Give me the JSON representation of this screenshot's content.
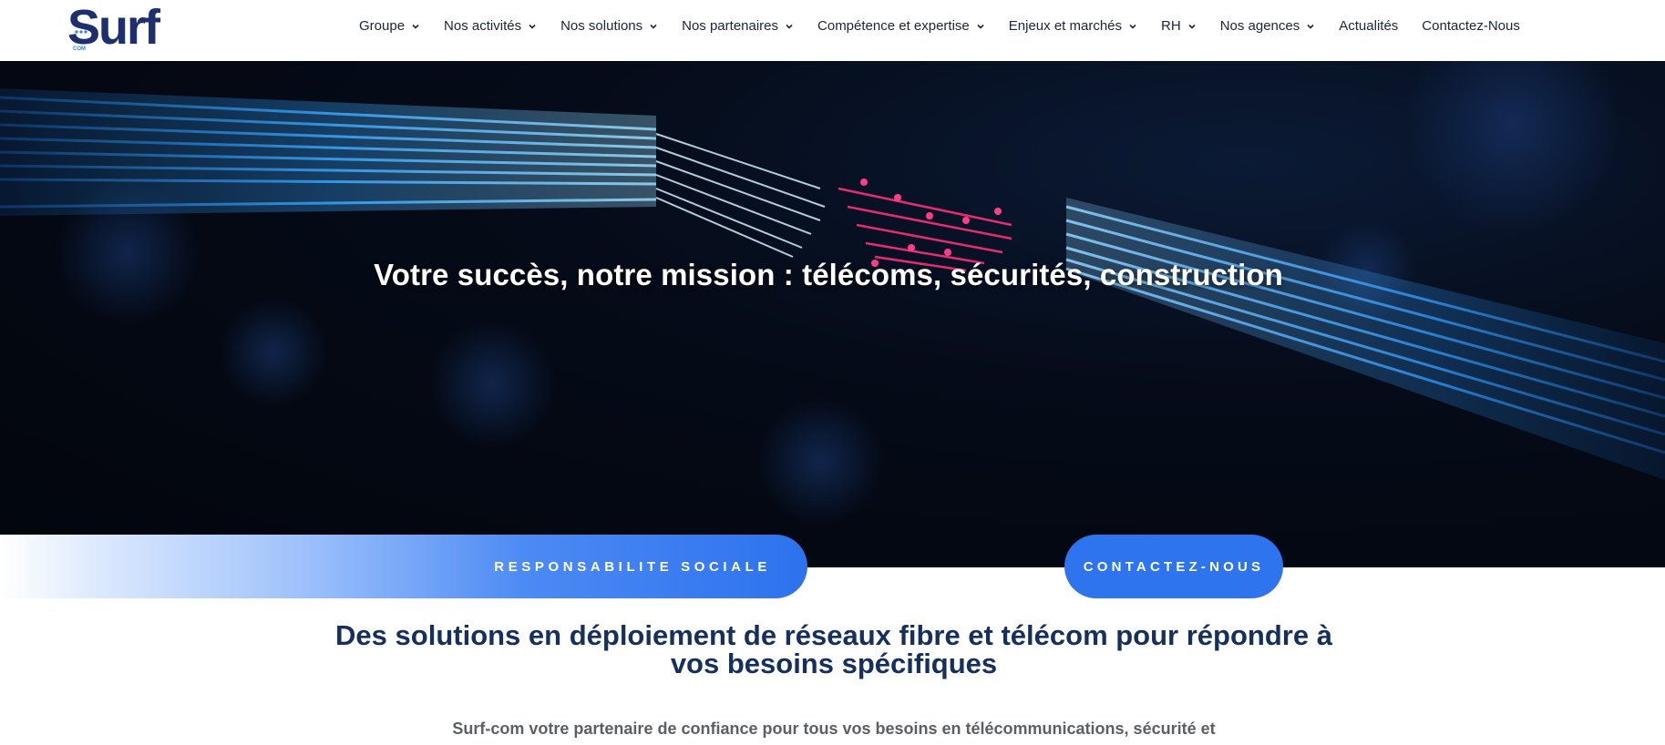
{
  "header": {
    "logo": {
      "brand": "Surf",
      "sub": "COM",
      "brand_color": "#1d2f6f",
      "accent_color": "#2f7ff0"
    },
    "nav": [
      {
        "label": "Groupe",
        "dropdown": true
      },
      {
        "label": "Nos activités",
        "dropdown": true
      },
      {
        "label": "Nos solutions",
        "dropdown": true
      },
      {
        "label": "Nos partenaires",
        "dropdown": true
      },
      {
        "label": "Compétence et expertise",
        "dropdown": true
      },
      {
        "label": "Enjeux et marchés",
        "dropdown": true
      },
      {
        "label": "RH",
        "dropdown": true
      },
      {
        "label": "Nos agences",
        "dropdown": true
      },
      {
        "label": "Actualités",
        "dropdown": false
      },
      {
        "label": "Contactez-Nous",
        "dropdown": false
      }
    ]
  },
  "hero": {
    "title": "Votre succès, notre mission : télécoms, sécurités, construction",
    "image": "fiber-optic-cable-image"
  },
  "buttons": {
    "social": "RESPONSABILITE SOCIALE",
    "contact": "CONTACTEZ-NOUS"
  },
  "main": {
    "heading_line1": "Des solutions en déploiement de réseaux fibre et télécom pour répondre à",
    "heading_line2": "vos besoins spécifiques",
    "intro": "Surf-com votre partenaire de confiance pour tous vos besoins en télécommunications, sécurité et"
  },
  "colors": {
    "primary_blue": "#2e74ee",
    "heading_navy": "#15305f",
    "nav_text": "#1b2440"
  }
}
